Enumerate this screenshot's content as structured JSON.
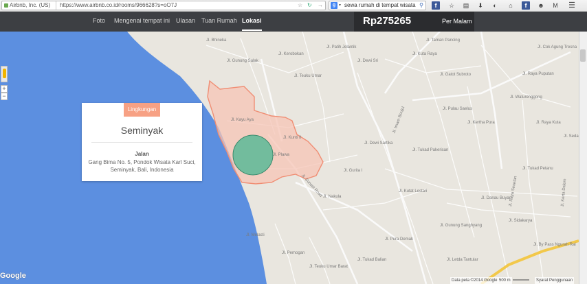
{
  "browser": {
    "site_identity": "Airbnb, Inc. (US)",
    "url": "https://www.airbnb.co.id/rooms/966628?s=oO7J",
    "search_query": "sewa rumah di tempat wisata",
    "search_engine_letter": "g",
    "icons": [
      "bookmark-star-icon",
      "reload-icon",
      "go-arrow-icon",
      "search-icon",
      "facebook-icon",
      "star-icon",
      "clipboard-icon",
      "download-icon",
      "translate-icon",
      "home-icon",
      "facebook-icon",
      "emoticon-icon",
      "gmail-icon",
      "menu-icon"
    ]
  },
  "nav": {
    "items": [
      "Foto",
      "Mengenai tempat ini",
      "Ulasan",
      "Tuan Rumah",
      "Lokasi"
    ],
    "active": "Lokasi",
    "price": "Rp275265",
    "per_label": "Per Malam"
  },
  "map": {
    "zoom_in": "+",
    "zoom_out": "−",
    "card": {
      "badge": "Lingkungan",
      "title": "Seminyak",
      "label": "Jalan",
      "address": "Gang Bima No. 5, Pondok Wisata Karl Suci, Seminyak, Bali, Indonesia"
    },
    "streets": [
      "Jl. Kayu Aya",
      "Jl. Kunti II",
      "Jl. Plawa",
      "Jl. Sunset Road",
      "Jl. Nakula",
      "Jl. Melasti",
      "Jl. Teuku Umar",
      "Jl. Imam Bonjol",
      "Jl. Pulau Saelus",
      "Jl. Raya Puputan",
      "Jl. Cok Agung Tresna",
      "Jl. Waturenggong",
      "Jl. Tukad Petanu",
      "Jl. By Pass Ngurah Rai",
      "Jl. Raya Sesetan",
      "Jl. Sidakarya",
      "Jl. Kerta Dalem",
      "Jl. Bhineka",
      "Jl. Gunung Salak",
      "Jl. Kerobokan",
      "Jl. Patih Jelantik",
      "Jl. Dewi Sri",
      "Jl. Kuta Raya",
      "Jl. Gatot Subroto",
      "Jl. Kertha Pura",
      "Jl. Tukad Pakerisan",
      "Jl. Dewi Sartika",
      "Jl. Gurita I",
      "Jl. Kutat Lestari",
      "Jl. Gunung Sanghyang",
      "Jl. Pura Demak",
      "Jl. Tukad Balian",
      "Jl. Pemogan",
      "Jl. Teuku Umar Barat",
      "Jl. Sedap Malam",
      "Jl. Letda Tantular",
      "Jl. Danau Buyan",
      "Jl. Taman Pancing",
      "Jl. Raya Kuta"
    ],
    "attribution_data": "Data peta ©2014 Google",
    "scale": "500 m",
    "terms": "Syarat Penggunaan",
    "logo_text": "Google",
    "colors": {
      "sea": "#5c8fe0",
      "land": "#e9e6df",
      "neighborhood_fill": "#f6c4b6",
      "neighborhood_border": "#f08d73",
      "location_circle": "#5bb896",
      "highway": "#f2c84a"
    }
  }
}
